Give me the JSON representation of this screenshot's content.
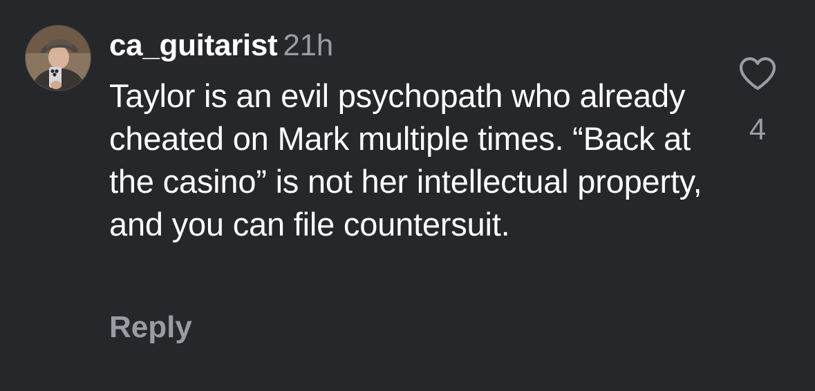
{
  "comment": {
    "username": "ca_guitarist",
    "time": "21h",
    "text": "Taylor is an evil psychopath who already cheated on Mark multiple times. “Back at the casino” is not her intellectual property, and you can file countersuit.",
    "reply_label": "Reply",
    "like_count": "4",
    "like_icon": "heart-outline-icon",
    "avatar_icon": "profile-photo"
  },
  "colors": {
    "background": "#26272b",
    "text_primary": "#ffffff",
    "text_secondary": "#9b9ca3"
  }
}
